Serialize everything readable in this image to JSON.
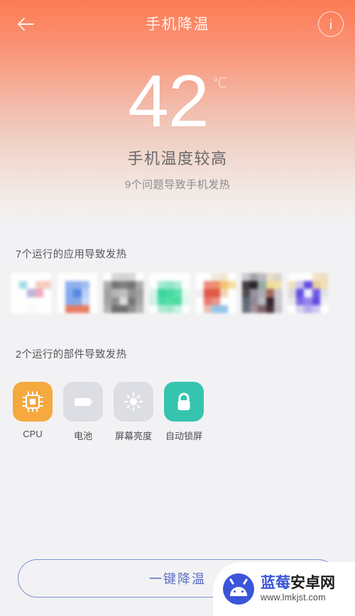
{
  "header": {
    "title": "手机降温",
    "back_icon": "arrow-left-icon",
    "info_icon": "info-circle-icon"
  },
  "temperature": {
    "value": "42",
    "unit": "℃",
    "status": "手机温度较高",
    "subtitle": "9个问题导致手机发热"
  },
  "apps_section": {
    "title": "7个运行的应用导致发热",
    "icons": [
      {
        "name": "app-icon-1",
        "blurred": true,
        "cells": [
          "#FFFFFF",
          "#FFFFFF",
          "#FFFFFF",
          "#FFFFFF",
          "#FFFFFF",
          "#FFFFFF",
          "#9FDCE8",
          "#FFFFFF",
          "#F6CBBD",
          "#F6CBBD",
          "#FFFFFF",
          "#FFFFFF",
          "#BDB2DC",
          "#EFA8C0",
          "#FFFFFF",
          "#FFFFFF",
          "#FFFFFF",
          "#FFFFFF",
          "#FFFFFF",
          "#FFFFFF",
          "#FFFFFF",
          "#FFFFFF",
          "#FAFAFA",
          "#FFFFFF",
          "#FFFFFF"
        ]
      },
      {
        "name": "app-icon-2",
        "blurred": true,
        "cells": [
          "#FFFFFF",
          "#FFFFFF",
          "#FFFFFF",
          "#FFFFFF",
          "#FFFFFF",
          "#FFFFFF",
          "#8AAEEE",
          "#8AAEEE",
          "#9CBBF0",
          "#FFFFFF",
          "#FFFFFF",
          "#7FA6EC",
          "#4E82E2",
          "#B9CDF4",
          "#FFFFFF",
          "#FFFFFF",
          "#7FA6EC",
          "#7FA6EC",
          "#C9D7F5",
          "#FFFFFF",
          "#FFFFFF",
          "#E8765C",
          "#E8765C",
          "#E8765C",
          "#FFFFFF"
        ]
      },
      {
        "name": "app-icon-3",
        "blurred": true,
        "cells": [
          "#FFFFFF",
          "#D6D6D6",
          "#D2D2D2",
          "#D6D6D6",
          "#FFFFFF",
          "#A8A8A8",
          "#6E6E6E",
          "#7A7A7A",
          "#6E6E6E",
          "#A8A8A8",
          "#9C9C9C",
          "#B4B4B4",
          "#BDBDBD",
          "#8C8C8C",
          "#9C9C9C",
          "#A0A0A0",
          "#8A8A8A",
          "#DADADA",
          "#707070",
          "#A0A0A0",
          "#ACACAC",
          "#6A6A6A",
          "#6A6A6A",
          "#8A8A8A",
          "#B0B0B0"
        ]
      },
      {
        "name": "app-icon-4",
        "blurred": true,
        "cells": [
          "#FFFFFF",
          "#FFFFFF",
          "#FFFFFF",
          "#FFFFFF",
          "#FFFFFF",
          "#FFFFFF",
          "#9FE8CF",
          "#8DE4C6",
          "#A9EBD6",
          "#FFFFFF",
          "#D4F4E7",
          "#2ED598",
          "#3FD89E",
          "#56DFAB",
          "#EAFAF3",
          "#C9F2E0",
          "#46D9A2",
          "#4ADC9E",
          "#44D89B",
          "#DFF7EC",
          "#FFFFFF",
          "#AEEBD5",
          "#9FE8CF",
          "#C6F2E2",
          "#FFFFFF"
        ]
      },
      {
        "name": "app-icon-5",
        "blurred": true,
        "cells": [
          "#FFFFFF",
          "#FFFFFF",
          "#EFEBE0",
          "#EFE6CE",
          "#FFFFFF",
          "#FFFFFF",
          "#EE8572",
          "#EE8A62",
          "#F2C26A",
          "#F5DD9B",
          "#F0EFEF",
          "#E0503F",
          "#E0503F",
          "#F0D3B0",
          "#FFFFFF",
          "#FFFFFF",
          "#E8766A",
          "#EC8F85",
          "#FFFFFF",
          "#FFFFFF",
          "#FFFFFF",
          "#EBB9AE",
          "#8FC2EA",
          "#8FC2EA",
          "#FFFFFF"
        ]
      },
      {
        "name": "app-icon-6",
        "blurred": true,
        "cells": [
          "#C6C6CC",
          "#9E9EA8",
          "#B6B6BC",
          "#E5DEC6",
          "#D6D2C6",
          "#3A3038",
          "#1E1820",
          "#8FA89E",
          "#F0DC92",
          "#F2E2A4",
          "#4A4048",
          "#8E8E98",
          "#A8A8B2",
          "#9E6250",
          "#C8C8CE",
          "#566470",
          "#8E8290",
          "#B6B6BE",
          "#2A1A24",
          "#C2C2C8",
          "#606A72",
          "#9E8A92",
          "#7A5A62",
          "#3A2830",
          "#BEBEC4"
        ]
      },
      {
        "name": "app-icon-7",
        "blurred": true,
        "cells": [
          "#FFFFFF",
          "#FFFFFF",
          "#FFFFFF",
          "#F2E2C4",
          "#EFDDBC",
          "#F0E0C0",
          "#C8C2EE",
          "#5A44E2",
          "#E8CE9A",
          "#F0DCB4",
          "#D8D8DC",
          "#5A44E2",
          "#F2F0FC",
          "#6A52E6",
          "#E2E2E6",
          "#E8E8EC",
          "#7A62E8",
          "#9282EE",
          "#5A44E2",
          "#F0F0F4",
          "#FFFFFF",
          "#D8D2F2",
          "#B4A8EE",
          "#CCC4F0",
          "#FFFFFF"
        ]
      }
    ]
  },
  "parts_section": {
    "title": "2个运行的部件导致发热",
    "items": [
      {
        "label": "CPU",
        "icon": "cpu-chip-icon",
        "color": "#F5A93F",
        "active": true
      },
      {
        "label": "电池",
        "icon": "battery-icon",
        "color": "#DCDEE3",
        "active": false
      },
      {
        "label": "屏幕亮度",
        "icon": "brightness-icon",
        "color": "#DCDEE3",
        "active": false
      },
      {
        "label": "自动锁屏",
        "icon": "lock-icon",
        "color": "#37C4AE",
        "active": true
      }
    ]
  },
  "cta": {
    "label": "一键降温",
    "color": "#5C6FC4"
  },
  "watermark": {
    "name_blue": "蓝莓",
    "name_dark": "安卓网",
    "url": "www.lmkjst.com",
    "logo_icon": "android-robot-icon"
  },
  "theme": {
    "gradient_top": "#FB7B55",
    "gradient_bottom": "#F2F1F1",
    "page_bg": "#F2F2F4"
  }
}
